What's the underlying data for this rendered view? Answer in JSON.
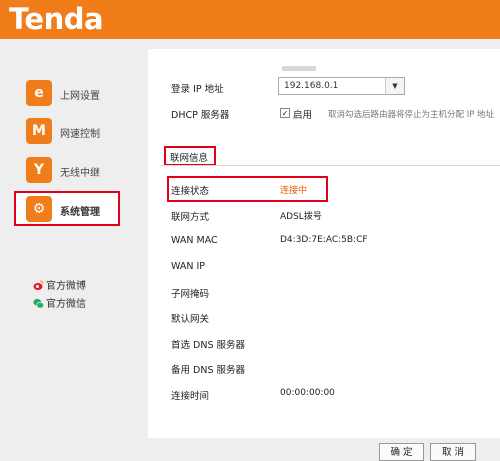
{
  "header": {
    "logo_text": "Tenda",
    "bg_color": "#f07d1a"
  },
  "sidebar": {
    "items": [
      {
        "label": "上网设置",
        "icon": "internet-e-icon",
        "glyph": "e"
      },
      {
        "label": "网速控制",
        "icon": "speed-wave-icon",
        "glyph": "M"
      },
      {
        "label": "无线中继",
        "icon": "wireless-repeater-icon",
        "glyph": "Y"
      },
      {
        "label": "系统管理",
        "icon": "system-gear-icon",
        "glyph": "⚙",
        "active": true
      }
    ],
    "social": [
      {
        "label": "官方微博",
        "icon": "weibo-icon"
      },
      {
        "label": "官方微信",
        "icon": "wechat-icon"
      }
    ]
  },
  "lan": {
    "login_ip_label": "登录 IP 地址",
    "login_ip_value": "192.168.0.1",
    "dhcp_label": "DHCP 服务器",
    "dhcp_enable_label": "启用",
    "dhcp_checked": true,
    "dhcp_note": "取消勾选后路由器将停止为主机分配 IP 地址"
  },
  "wan": {
    "section_title": "联网信息",
    "rows": [
      {
        "label": "连接状态",
        "value": "连接中",
        "status": true
      },
      {
        "label": "联网方式",
        "value": "ADSL拨号"
      },
      {
        "label": "WAN MAC",
        "value": "D4:3D:7E:AC:5B:CF"
      },
      {
        "label": "WAN IP",
        "value": ""
      },
      {
        "label": "子网掩码",
        "value": ""
      },
      {
        "label": "默认网关",
        "value": ""
      },
      {
        "label": "首选 DNS 服务器",
        "value": ""
      },
      {
        "label": "备用 DNS 服务器",
        "value": ""
      },
      {
        "label": "连接时间",
        "value": "00:00:00:00"
      }
    ]
  },
  "footer": {
    "ok_label": "确 定",
    "cancel_label": "取 消"
  },
  "colors": {
    "accent": "#f07d1a",
    "highlight_border": "#e2001a",
    "status_text": "#e8610a"
  }
}
